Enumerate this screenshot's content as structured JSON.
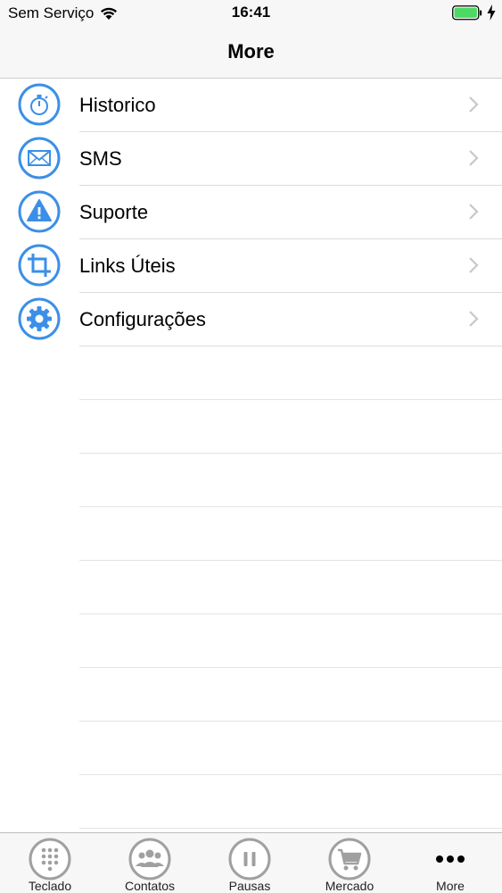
{
  "status_bar": {
    "carrier": "Sem Serviço",
    "time": "16:41"
  },
  "nav": {
    "title": "More"
  },
  "menu": {
    "items": [
      {
        "label": "Historico",
        "icon": "stopwatch-icon"
      },
      {
        "label": "SMS",
        "icon": "envelope-icon"
      },
      {
        "label": "Suporte",
        "icon": "warning-icon"
      },
      {
        "label": "Links Úteis",
        "icon": "crop-icon"
      },
      {
        "label": "Configurações",
        "icon": "gear-icon"
      }
    ]
  },
  "tab_bar": {
    "tabs": [
      {
        "label": "Teclado",
        "icon": "keypad-icon"
      },
      {
        "label": "Contatos",
        "icon": "contacts-icon"
      },
      {
        "label": "Pausas",
        "icon": "pause-icon"
      },
      {
        "label": "Mercado",
        "icon": "cart-icon"
      },
      {
        "label": "More",
        "icon": "more-dots-icon"
      }
    ]
  },
  "colors": {
    "accent": "#3b8fe8",
    "tab_icon": "#9a9a9a",
    "battery": "#4cd964"
  }
}
